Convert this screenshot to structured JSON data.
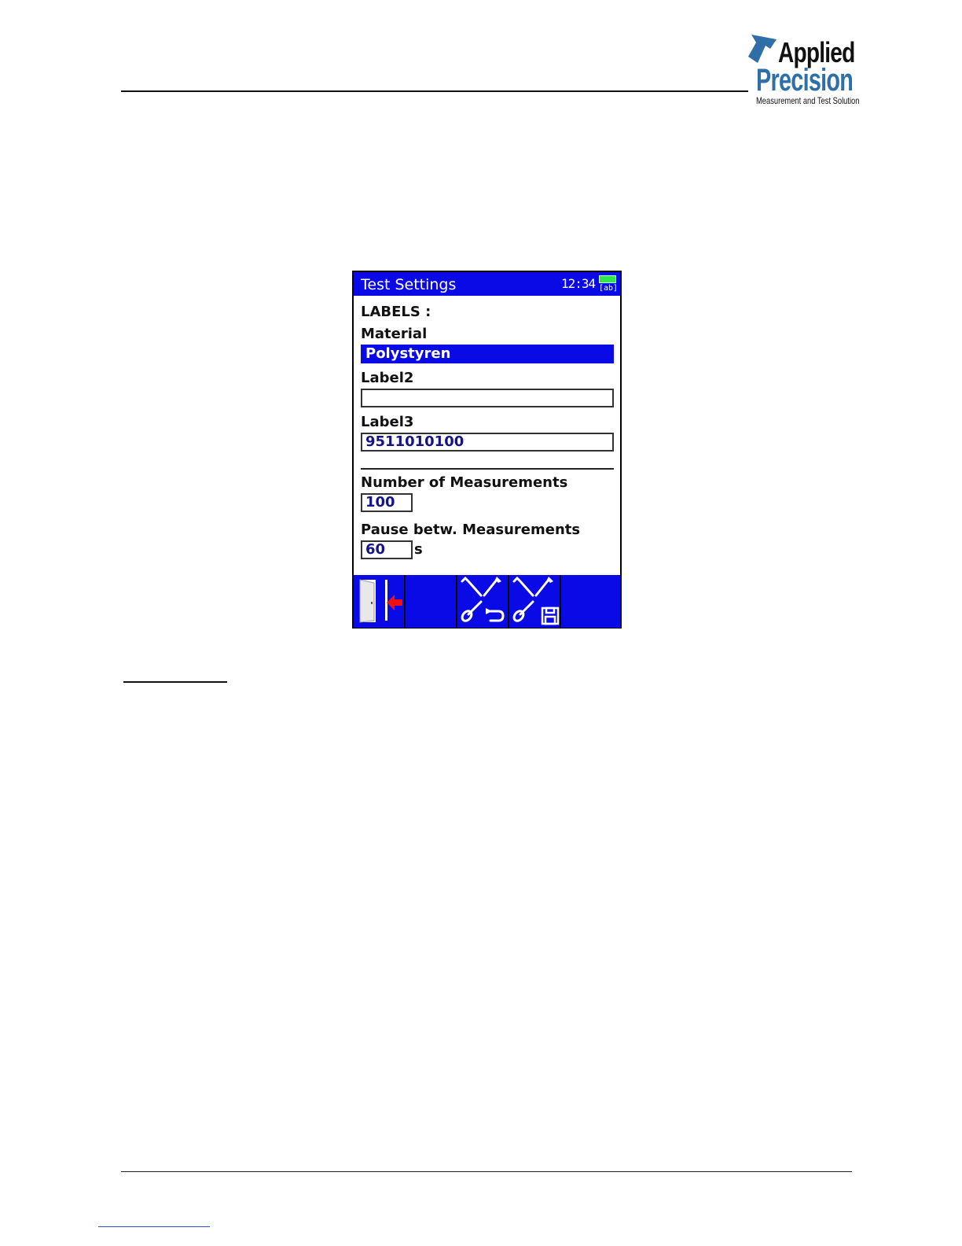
{
  "brand": {
    "name_line1": "Applied",
    "name_line2": "Precision",
    "tagline": "Measurement and Test Solution",
    "colors": {
      "primary": "#2f6fa8",
      "dark": "#111111"
    }
  },
  "device": {
    "title": "Test Settings",
    "clock": "12:34",
    "battery_icon": "battery-full-icon",
    "input_mode": "[ab]",
    "colors": {
      "accent": "#0a0ae6",
      "value_text": "#141488",
      "battery": "#2ee84a"
    },
    "labels_heading": "LABELS :",
    "fields": {
      "material": {
        "label": "Material",
        "value": "Polystyren"
      },
      "label2": {
        "label": "Label2",
        "value": ""
      },
      "label3": {
        "label": "Label3",
        "value": "9511010100"
      },
      "measurements": {
        "label": "Number of Measurements",
        "value": "100"
      },
      "pause": {
        "label": "Pause betw. Measurements",
        "value": "60",
        "unit": "s"
      }
    },
    "toolbar": [
      {
        "icon": "exit-door-icon"
      },
      {
        "icon": "empty-slot"
      },
      {
        "icon": "tools-undo-icon"
      },
      {
        "icon": "tools-save-icon"
      },
      {
        "icon": "empty-slot"
      }
    ]
  }
}
